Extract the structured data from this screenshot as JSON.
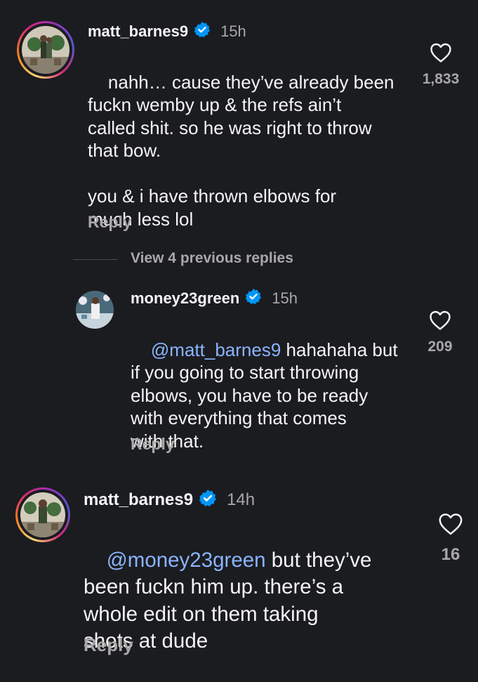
{
  "comments": [
    {
      "username": "matt_barnes9",
      "time": "15h",
      "text": "nahh… cause they’ve already been\nfuckn wemby up & the refs ain’t\ncalled shit. so he was right to throw\nthat bow.\n\nyou & i have thrown elbows for\nmuch less lol",
      "likes": "1,833",
      "reply_label": "Reply"
    },
    {
      "username": "money23green",
      "time": "15h",
      "mention": "@matt_barnes9",
      "text": " hahahaha but\nif you going to start throwing\nelbows, you have to be ready\nwith everything that comes\nwith that.",
      "likes": "209",
      "reply_label": "Reply"
    },
    {
      "username": "matt_barnes9",
      "time": "14h",
      "mention": "@money23green",
      "text": " but they’ve\nbeen fuckn him up. there’s a\nwhole edit on them taking\nshots at dude",
      "likes": "16",
      "reply_label": "Reply"
    }
  ],
  "view_replies": "View 4 previous replies",
  "colors": {
    "background": "#1b1c20",
    "verified": "#0095f6",
    "mention": "#8ab4ff",
    "muted": "#a8a8a8"
  },
  "icons": {
    "like": "heart-outline-icon",
    "verified": "verified-badge-icon"
  }
}
